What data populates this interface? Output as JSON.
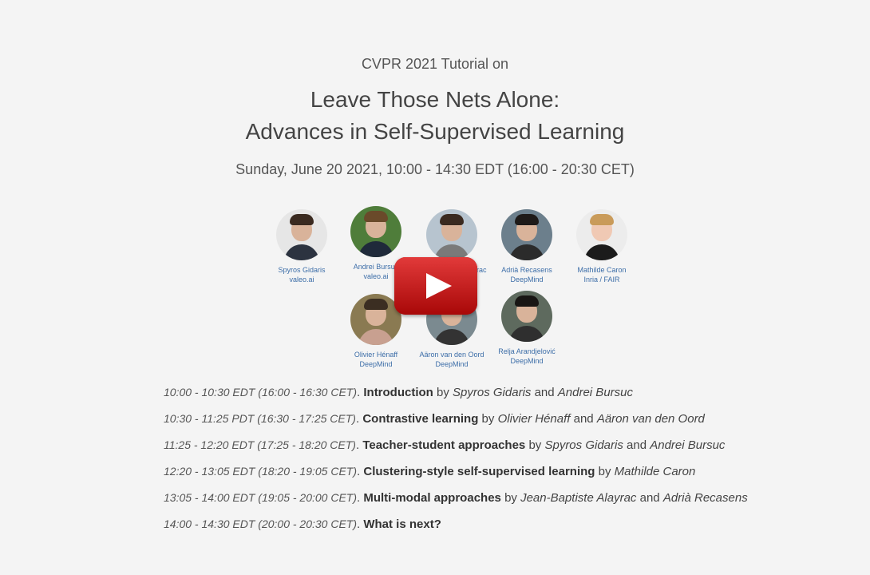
{
  "header": {
    "subtitle": "CVPR 2021 Tutorial on",
    "title_line1": "Leave Those Nets Alone:",
    "title_line2": "Advances in Self-Supervised Learning",
    "date": "Sunday, June 20 2021, 10:00 - 14:30 EDT (16:00 - 20:30 CET)"
  },
  "speakers": [
    {
      "name": "Spyros Gidaris",
      "org": "valeo.ai"
    },
    {
      "name": "Andrei Bursuc",
      "org": "valeo.ai"
    },
    {
      "name": "Jean-Baptiste Alayrac",
      "org": "DeepMind"
    },
    {
      "name": "Adrià Recasens",
      "org": "DeepMind"
    },
    {
      "name": "Mathilde Caron",
      "org": "Inria / FAIR"
    },
    {
      "name": "Olivier Hénaff",
      "org": "DeepMind"
    },
    {
      "name": "Aäron van den Oord",
      "org": "DeepMind"
    },
    {
      "name": "Relja Arandjelović",
      "org": "DeepMind"
    }
  ],
  "video": {
    "play_icon": "youtube-play-icon",
    "color": "#c51111"
  },
  "schedule": [
    {
      "time": "10:00 - 10:30 EDT (16:00 - 16:30 CET)",
      "sep": ".",
      "topic": "Introduction",
      "by": "by",
      "speaker1": "Spyros Gidaris",
      "and": "and",
      "speaker2": "Andrei Bursuc"
    },
    {
      "time": "10:30 - 11:25 PDT (16:30 - 17:25 CET)",
      "sep": ".",
      "topic": "Contrastive learning",
      "by": "by",
      "speaker1": "Olivier Hénaff",
      "and": "and",
      "speaker2": "Aäron van den Oord"
    },
    {
      "time": "11:25 - 12:20 EDT (17:25 - 18:20 CET)",
      "sep": ".",
      "topic": "Teacher-student approaches",
      "by": "by",
      "speaker1": "Spyros Gidaris",
      "and": "and",
      "speaker2": "Andrei Bursuc"
    },
    {
      "time": "12:20 - 13:05 EDT (18:20 - 19:05 CET)",
      "sep": ".",
      "topic": "Clustering-style self-supervised learning",
      "by": "by",
      "speaker1": "Mathilde Caron",
      "and": "",
      "speaker2": ""
    },
    {
      "time": "13:05 - 14:00 EDT (19:05 - 20:00 CET)",
      "sep": ".",
      "topic": "Multi-modal approaches",
      "by": "by",
      "speaker1": "Jean-Baptiste Alayrac",
      "and": "and",
      "speaker2": "Adrià Recasens"
    },
    {
      "time": "14:00 - 14:30 EDT (20:00 - 20:30 CET)",
      "sep": ".",
      "topic": "What is next?",
      "by": "",
      "speaker1": "",
      "and": "",
      "speaker2": ""
    }
  ]
}
